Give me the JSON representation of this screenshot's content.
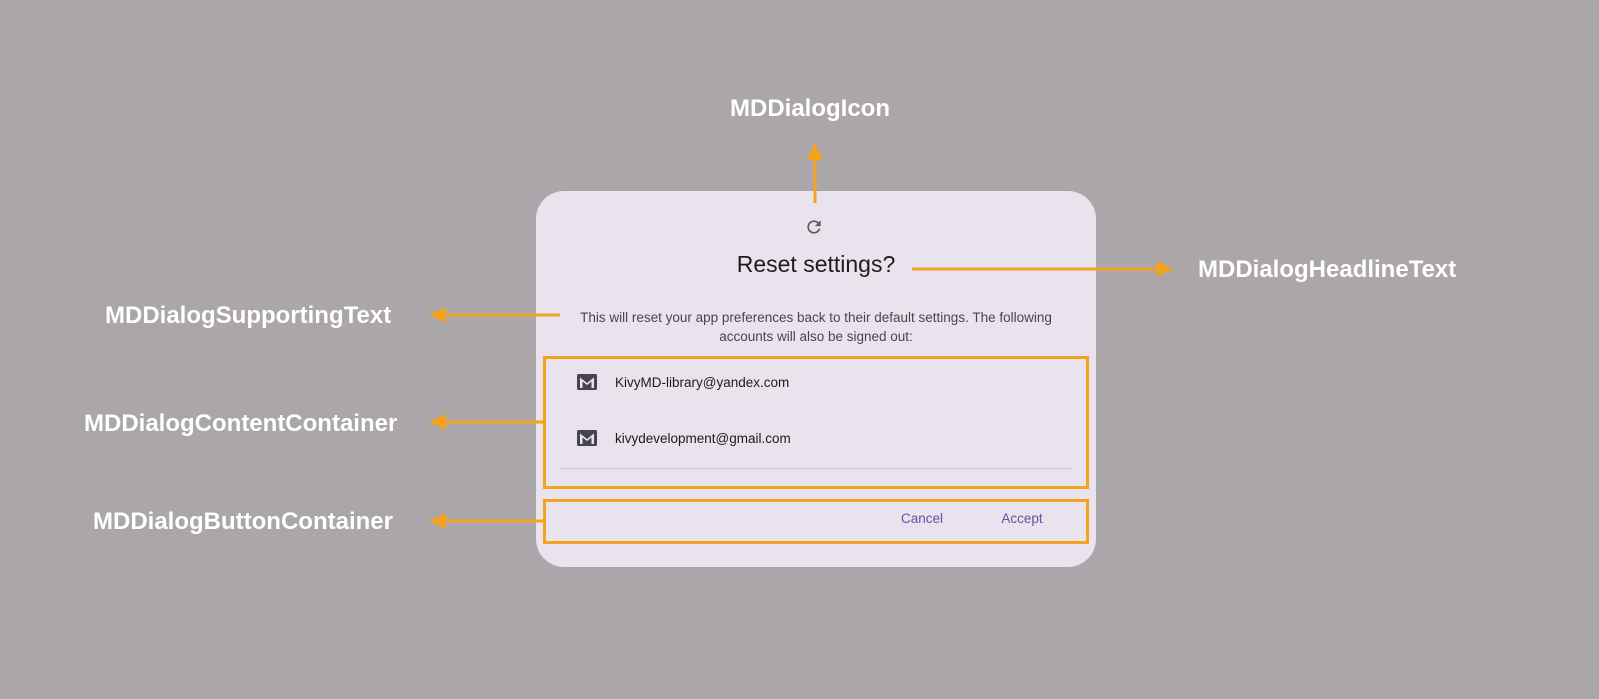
{
  "annotations": {
    "icon": "MDDialogIcon",
    "headline_text": "MDDialogHeadlineText",
    "supporting_text": "MDDialogSupportingText",
    "content_container": "MDDialogContentContainer",
    "button_container": "MDDialogButtonContainer"
  },
  "dialog": {
    "icon": "refresh-icon",
    "headline": "Reset settings?",
    "supporting_text": "This will reset your app preferences back to their default settings. The following accounts will also be signed out:",
    "accounts": [
      {
        "icon": "gmail-icon",
        "email": "KivyMD-library@yandex.com"
      },
      {
        "icon": "gmail-icon",
        "email": "kivydevelopment@gmail.com"
      }
    ],
    "buttons": {
      "cancel": "Cancel",
      "accept": "Accept"
    }
  },
  "colors": {
    "background": "#aaa6a9",
    "dialog_surface": "#e8e3ec",
    "annotation": "#f5a21f",
    "primary": "#6750a4"
  }
}
